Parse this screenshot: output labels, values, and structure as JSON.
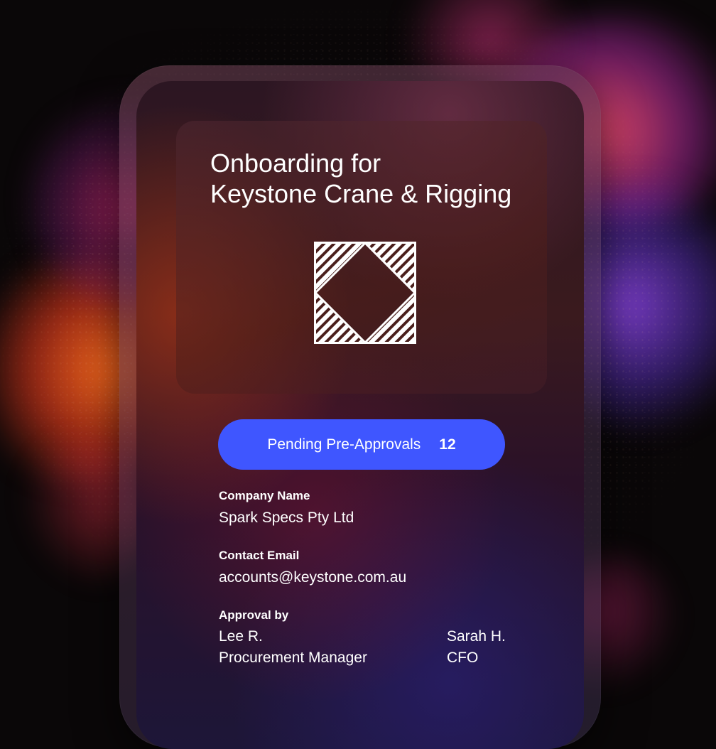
{
  "colors": {
    "accent": "#3f56ff",
    "text": "#ffffff"
  },
  "hero": {
    "title_line1": "Onboarding for",
    "title_line2": "Keystone Crane & Rigging",
    "logo_icon": "diamond-hatched-logo"
  },
  "pending": {
    "label": "Pending Pre-Approvals",
    "count": "12"
  },
  "company": {
    "label": "Company Name",
    "value": "Spark Specs Pty Ltd"
  },
  "contact": {
    "label": "Contact Email",
    "value": "accounts@keystone.com.au"
  },
  "approval": {
    "label": "Approval by",
    "approvers": [
      {
        "name": "Lee R.",
        "title": "Procurement Manager"
      },
      {
        "name": "Sarah H.",
        "title": "CFO"
      }
    ]
  }
}
